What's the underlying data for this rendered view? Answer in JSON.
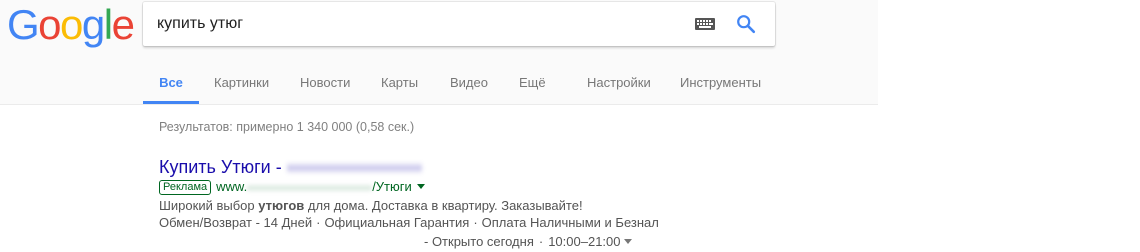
{
  "logo": {
    "letters": [
      "G",
      "o",
      "o",
      "g",
      "l",
      "e"
    ],
    "colors": [
      "#4285F4",
      "#EA4335",
      "#FBBC05",
      "#4285F4",
      "#34A853",
      "#EA4335"
    ]
  },
  "search": {
    "value": "купить утюг",
    "keyboard_icon": "keyboard-icon",
    "search_icon": "search-icon"
  },
  "tabs": [
    {
      "label": "Все",
      "active": true
    },
    {
      "label": "Картинки"
    },
    {
      "label": "Новости"
    },
    {
      "label": "Карты"
    },
    {
      "label": "Видео"
    },
    {
      "label": "Ещё"
    },
    {
      "label": "Настройки"
    },
    {
      "label": "Инструменты"
    }
  ],
  "results": {
    "stats": "Результатов: примерно 1 340 000 (0,58 сек.)"
  },
  "ad": {
    "title_prefix": "Купить Утюги - ",
    "badge": "Реклама",
    "url_prefix": "www.",
    "url_suffix": "/Утюги",
    "desc_before": "Широкий выбор ",
    "desc_bold": "утюгов",
    "desc_after": " для дома. Доставка в квартиру. Заказывайте!",
    "sitelinks": [
      "Обмен/Возврат - 14 Дней",
      "Официальная Гарантия",
      "Оплата Наличными и Безнал"
    ],
    "separator": "·",
    "hours_prefix": "- Открыто сегодня",
    "hours_value": "10:00–21:00"
  },
  "colors": {
    "accent": "#4285f4",
    "link": "#1a0dab",
    "url_green": "#006621",
    "text_gray": "#545454"
  }
}
